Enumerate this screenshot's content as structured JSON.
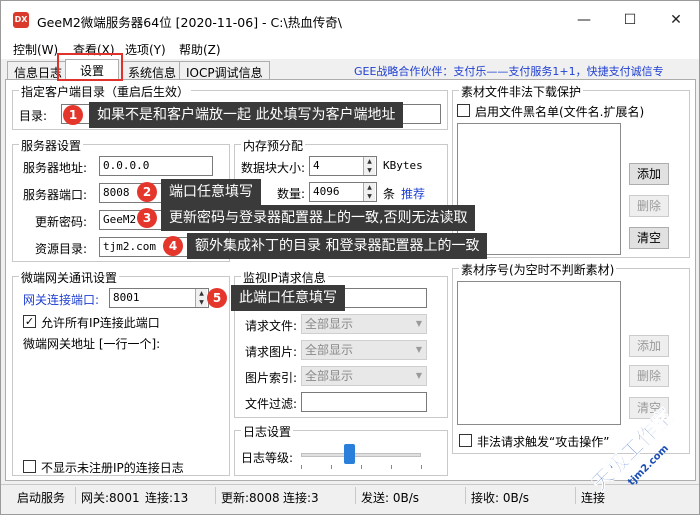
{
  "window": {
    "icon_text": "DX",
    "title": "GeeM2微端服务器64位 [2020-11-06] - C:\\热血传奇\\",
    "minimize": "—",
    "maximize": "☐",
    "close": "✕"
  },
  "menu": [
    "控制(W)",
    "查看(X)",
    "选项(Y)",
    "帮助(Z)"
  ],
  "tabs": [
    "信息日志",
    "设置",
    "系统信息",
    "IOCP调试信息"
  ],
  "marquee": "GEE战略合作伙伴：支付乐——支付服务1+1，快捷支付诚信专",
  "client_dir": {
    "title": "指定客户端目录（重启后生效）",
    "label": "目录:",
    "value": ""
  },
  "server": {
    "title": "服务器设置",
    "addr_label": "服务器地址:",
    "addr_value": "0.0.0.0",
    "port_label": "服务器端口:",
    "port_value": "8008",
    "pwd_label": "更新密码:",
    "pwd_value": "GeeM2",
    "res_label": "资源目录:",
    "res_value": "tjm2.com"
  },
  "memory": {
    "title": "内存预分配",
    "block_label": "数据块大小:",
    "block_value": "4",
    "block_unit": "KBytes",
    "count_label": "数量:",
    "count_value": "4096",
    "count_unit": "条",
    "recommend": "推荐"
  },
  "gateway": {
    "title": "微端网关通讯设置",
    "port_label": "网关连接端口:",
    "port_value": "8001",
    "allow_ip_label": "允许所有IP连接此端口",
    "allow_ip_checked": true,
    "addr_label": "微端网关地址 [一行一个]:",
    "hide_unreg_label": "不显示未注册IP的连接日志",
    "hide_unreg_checked": false
  },
  "monitor": {
    "title": "监视IP请求信息",
    "req_file_label": "请求文件:",
    "req_file_value": "全部显示",
    "req_img_label": "请求图片:",
    "req_img_value": "全部显示",
    "img_index_label": "图片索引:",
    "img_index_value": "全部显示",
    "file_filter_label": "文件过滤:"
  },
  "log": {
    "title": "日志设置",
    "level_label": "日志等级:",
    "level_fraction": 0.4
  },
  "download_protect": {
    "title": "素材文件非法下载保护",
    "blacklist_label": "启用文件黑名单(文件名.扩展名)",
    "add": "添加",
    "delete": "删除",
    "clear": "清空"
  },
  "material": {
    "title": "素材序号(为空时不判断素材)",
    "add": "添加",
    "delete": "删除",
    "clear": "清空",
    "attack_label": "非法请求触发“攻击操作”"
  },
  "status": {
    "start": "启动服务",
    "gateway": "网关:8001",
    "gateway_conn": "连接:13",
    "update": "更新:8008",
    "update_conn": "连接:3",
    "send": "发送: 0B/s",
    "recv": "接收: 0B/s",
    "conn": "连接"
  },
  "callouts": [
    {
      "num": "1",
      "text": "如果不是和客户端放一起 此处填写为客户端地址"
    },
    {
      "num": "2",
      "text": "端口任意填写"
    },
    {
      "num": "3",
      "text": "更新密码与登录器配置器上的一致,否则无法读取"
    },
    {
      "num": "4",
      "text": "额外集成补丁的目录 和登录器配置器上的一致"
    },
    {
      "num": "5",
      "text": "此端口任意填写"
    }
  ],
  "watermark": {
    "line1": "天极工作室",
    "line2": "tjm2.com"
  },
  "colors": {
    "accent_red": "#e5362b",
    "link_blue": "#1f3fd1",
    "callout_bg": "#3a3a3a"
  }
}
